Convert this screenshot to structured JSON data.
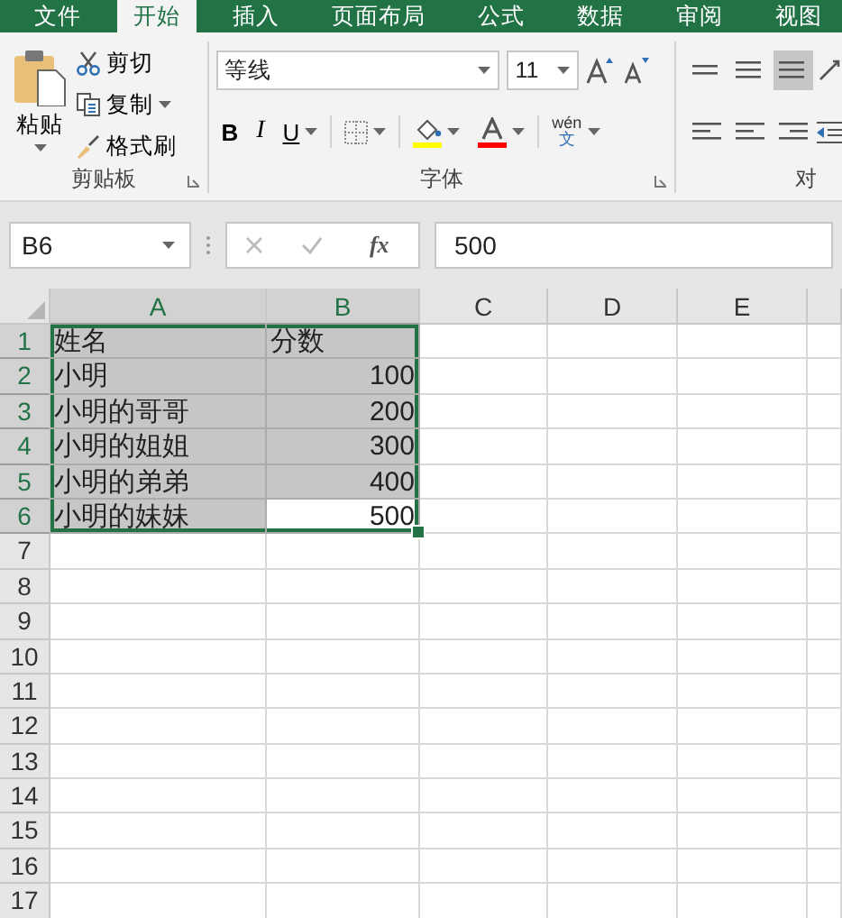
{
  "tabs": [
    {
      "label": "文件",
      "selected": false
    },
    {
      "label": "开始",
      "selected": true
    },
    {
      "label": "插入",
      "selected": false
    },
    {
      "label": "页面布局",
      "selected": false
    },
    {
      "label": "公式",
      "selected": false
    },
    {
      "label": "数据",
      "selected": false
    },
    {
      "label": "审阅",
      "selected": false
    },
    {
      "label": "视图",
      "selected": false
    }
  ],
  "clipboard": {
    "paste": "粘贴",
    "cut": "剪切",
    "copy": "复制",
    "format_painter": "格式刷",
    "group_label": "剪贴板"
  },
  "font": {
    "name": "等线",
    "size": "11",
    "bold": "B",
    "italic": "I",
    "underline": "U",
    "phonetic_top": "wén",
    "phonetic_bottom": "文",
    "group_label": "字体"
  },
  "alignment": {
    "group_label": "对",
    "vertical_buttons": [
      {
        "selected": false
      },
      {
        "selected": false
      },
      {
        "selected": true
      }
    ]
  },
  "formula_bar": {
    "name_box": "B6",
    "fx": "fx",
    "value": "500"
  },
  "columns": [
    {
      "label": "A",
      "selected": true
    },
    {
      "label": "B",
      "selected": true
    },
    {
      "label": "C",
      "selected": false
    },
    {
      "label": "D",
      "selected": false
    },
    {
      "label": "E",
      "selected": false
    }
  ],
  "rows": [
    {
      "label": "1",
      "selected": true,
      "cells": [
        {
          "text": "姓名",
          "kind": "text",
          "selected": true,
          "active": false
        },
        {
          "text": "分数",
          "kind": "text",
          "selected": true,
          "active": false
        }
      ]
    },
    {
      "label": "2",
      "selected": true,
      "cells": [
        {
          "text": "小明",
          "kind": "text",
          "selected": true,
          "active": false
        },
        {
          "text": "100",
          "kind": "number",
          "selected": true,
          "active": false
        }
      ]
    },
    {
      "label": "3",
      "selected": true,
      "cells": [
        {
          "text": "小明的哥哥",
          "kind": "text",
          "selected": true,
          "active": false
        },
        {
          "text": "200",
          "kind": "number",
          "selected": true,
          "active": false
        }
      ]
    },
    {
      "label": "4",
      "selected": true,
      "cells": [
        {
          "text": "小明的姐姐",
          "kind": "text",
          "selected": true,
          "active": false
        },
        {
          "text": "300",
          "kind": "number",
          "selected": true,
          "active": false
        }
      ]
    },
    {
      "label": "5",
      "selected": true,
      "cells": [
        {
          "text": "小明的弟弟",
          "kind": "text",
          "selected": true,
          "active": false
        },
        {
          "text": "400",
          "kind": "number",
          "selected": true,
          "active": false
        }
      ]
    },
    {
      "label": "6",
      "selected": true,
      "cells": [
        {
          "text": "小明的妹妹",
          "kind": "text",
          "selected": true,
          "active": false
        },
        {
          "text": "500",
          "kind": "number",
          "selected": true,
          "active": true
        }
      ]
    },
    {
      "label": "7",
      "selected": false
    },
    {
      "label": "8",
      "selected": false
    },
    {
      "label": "9",
      "selected": false
    },
    {
      "label": "10",
      "selected": false
    },
    {
      "label": "11",
      "selected": false
    },
    {
      "label": "12",
      "selected": false
    },
    {
      "label": "13",
      "selected": false
    },
    {
      "label": "14",
      "selected": false
    },
    {
      "label": "15",
      "selected": false
    },
    {
      "label": "16",
      "selected": false
    },
    {
      "label": "17",
      "selected": false
    }
  ]
}
